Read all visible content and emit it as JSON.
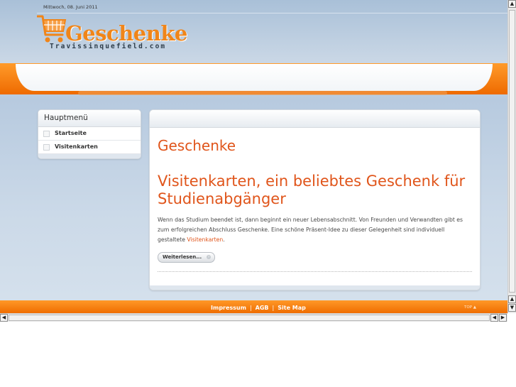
{
  "header": {
    "date": "Mittwoch, 08. Juni 2011",
    "logo_title": "Geschenke",
    "logo_subtitle": "Travissinquefield.com"
  },
  "sidebar": {
    "title": "Hauptmenü",
    "items": [
      {
        "label": "Startseite"
      },
      {
        "label": "Visitenkarten"
      }
    ]
  },
  "content": {
    "site_heading": "Geschenke",
    "article_title": "Visitenkarten, ein beliebtes Geschenk für Studienabgänger",
    "article_body": "Wenn das Studium beendet ist, dann beginnt ein neuer Lebensabschnitt. Von Freunden und Verwandten gibt es zum erfolgreichen Abschluss Geschenke. Eine schöne Präsent-Idee zu dieser Gelegenheit sind individuell gestaltete ",
    "article_link": "Visitenkarten",
    "article_end": ".",
    "read_more": "Weiterlesen..."
  },
  "footer": {
    "links": [
      "Impressum",
      "AGB",
      "Site Map"
    ],
    "separator": "|",
    "top_label": "TOP ▲"
  },
  "scrollbars": {
    "up": "▲",
    "down": "▼",
    "left": "◀",
    "right": "▶"
  },
  "colors": {
    "accent_orange": "#f08519",
    "heading_orange": "#e0551b",
    "background_blue": "#c6d5e5"
  }
}
